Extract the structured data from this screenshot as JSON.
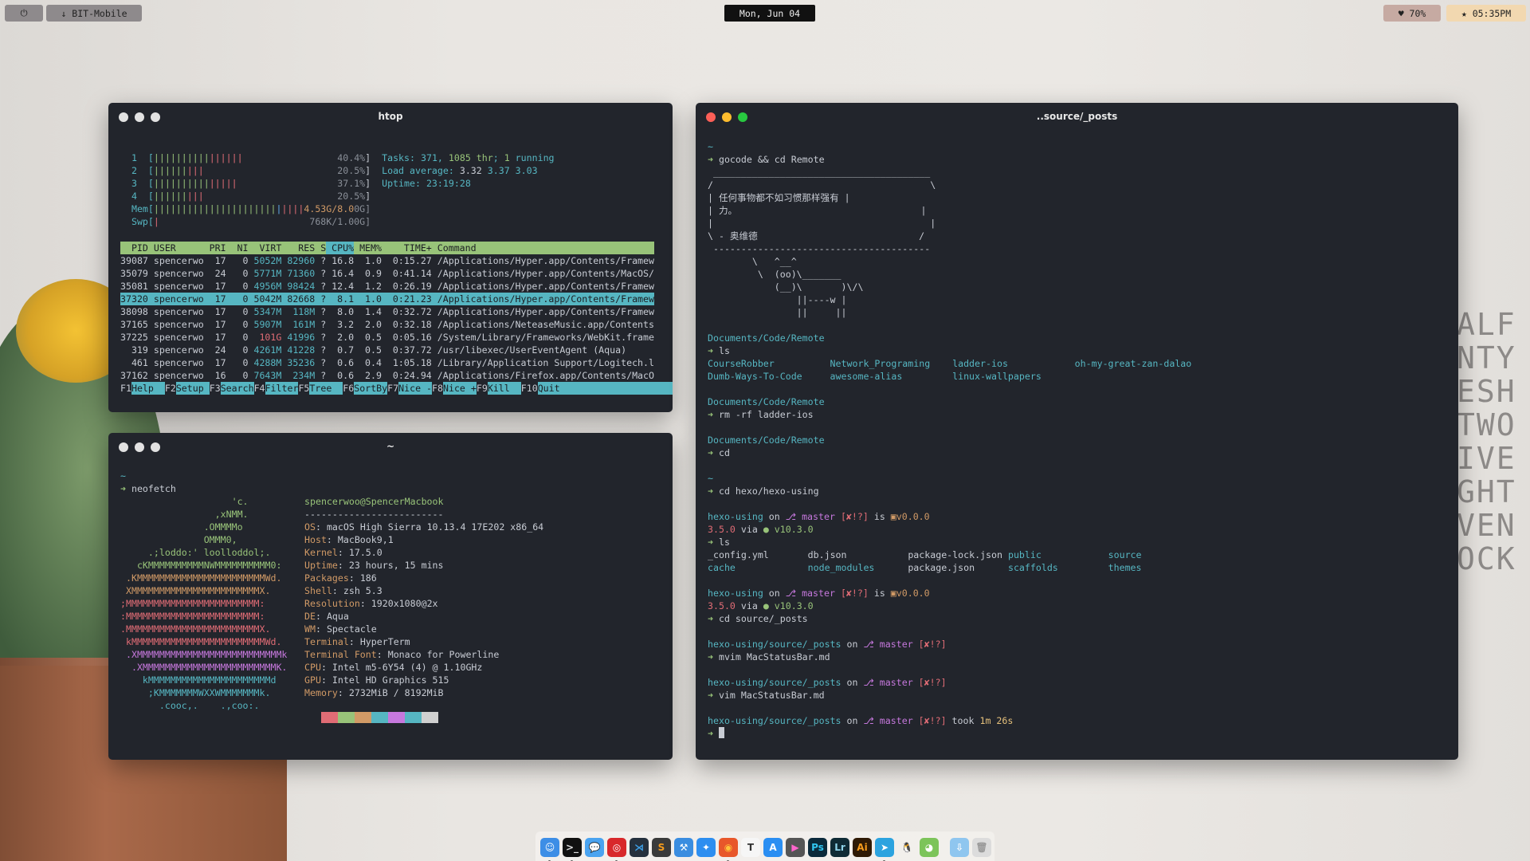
{
  "topbar": {
    "power_icon": "⏻",
    "wifi": "↓ BIT-Mobile",
    "date": "Mon, Jun 04",
    "battery": "♥ 70%",
    "time": "★ 05:35PM"
  },
  "wallpaper": {
    "words": [
      "ALF",
      "NTY",
      "ESH",
      "TWO",
      "IVE",
      "GHT",
      "VEN",
      "OCK"
    ]
  },
  "colors": {
    "terminal_bg": "#22252c",
    "cyan": "#56b6c2",
    "green": "#98c379",
    "red": "#e06c75",
    "magenta": "#c678dd",
    "orange": "#d19a66"
  },
  "htop": {
    "title": "htop",
    "meters": [
      [
        [
          "  1  [",
          "c"
        ],
        [
          "||||||||||",
          "g"
        ],
        [
          "||||||",
          "r"
        ],
        [
          "                 ",
          ""
        ],
        [
          "40.4%",
          "d"
        ],
        [
          "]",
          "w"
        ],
        [
          "  Tasks: ",
          "c"
        ],
        [
          "371, ",
          "c"
        ],
        [
          "1085 thr",
          "g"
        ],
        [
          "; ",
          "c"
        ],
        [
          "1",
          "g"
        ],
        [
          " running",
          "c"
        ]
      ],
      [
        [
          "  2  [",
          "c"
        ],
        [
          "||||||",
          "g"
        ],
        [
          "|||",
          "r"
        ],
        [
          "                        ",
          ""
        ],
        [
          "20.5%",
          "d"
        ],
        [
          "]",
          "w"
        ],
        [
          "  Load average: ",
          "c"
        ],
        [
          "3.32 ",
          "w"
        ],
        [
          "3.37 ",
          "c"
        ],
        [
          "3.03",
          "c"
        ]
      ],
      [
        [
          "  3  [",
          "c"
        ],
        [
          "||||||||||",
          "g"
        ],
        [
          "|||||",
          "r"
        ],
        [
          "                  ",
          ""
        ],
        [
          "37.1%",
          "d"
        ],
        [
          "]",
          "w"
        ],
        [
          "  Uptime: ",
          "c"
        ],
        [
          "23:19:28",
          "c"
        ]
      ],
      [
        [
          "  4  [",
          "c"
        ],
        [
          "||||||",
          "g"
        ],
        [
          "|||",
          "r"
        ],
        [
          "                        ",
          ""
        ],
        [
          "20.5%",
          "d"
        ],
        [
          "]",
          "w"
        ]
      ],
      [
        [
          "  Mem[",
          "c"
        ],
        [
          "||||||||||||||||||||||",
          "g"
        ],
        [
          "|",
          "b"
        ],
        [
          "||||",
          "r"
        ],
        [
          "4.53G/8.0",
          "o"
        ],
        [
          "0G]",
          "d"
        ]
      ],
      [
        [
          "  Swp[",
          "c"
        ],
        [
          "|",
          "r"
        ],
        [
          "                           ",
          ""
        ],
        [
          "768K/1.00G]",
          "d"
        ]
      ]
    ],
    "columns": [
      "PID",
      "USER",
      "PRI",
      "NI",
      "VIRT",
      "RES",
      "S",
      "CPU%",
      "MEM%",
      "TIME+",
      "Command"
    ],
    "sort_column": "CPU%",
    "selected_pid": "37320",
    "processes": [
      {
        "pid": "39087",
        "user": "spencerwo",
        "pri": "17",
        "ni": "0",
        "virt": "5052M",
        "res": "82960",
        "s": "?",
        "cpu": "16.8",
        "mem": "1.0",
        "time": "0:15.27",
        "cmd": "/Applications/Hyper.app/Contents/Framew"
      },
      {
        "pid": "35079",
        "user": "spencerwo",
        "pri": "24",
        "ni": "0",
        "virt": "5771M",
        "res": "71360",
        "s": "?",
        "cpu": "16.4",
        "mem": "0.9",
        "time": "0:41.14",
        "cmd": "/Applications/Hyper.app/Contents/MacOS/"
      },
      {
        "pid": "35081",
        "user": "spencerwo",
        "pri": "17",
        "ni": "0",
        "virt": "4956M",
        "res": "98424",
        "s": "?",
        "cpu": "12.4",
        "mem": "1.2",
        "time": "0:26.19",
        "cmd": "/Applications/Hyper.app/Contents/Framew"
      },
      {
        "pid": "37320",
        "user": "spencerwo",
        "pri": "17",
        "ni": "0",
        "virt": "5042M",
        "res": "82668",
        "s": "?",
        "cpu": "8.1",
        "mem": "1.0",
        "time": "0:21.23",
        "cmd": "/Applications/Hyper.app/Contents/Framew"
      },
      {
        "pid": "38098",
        "user": "spencerwo",
        "pri": "17",
        "ni": "0",
        "virt": "5347M",
        "res": "118M",
        "s": "?",
        "cpu": "8.0",
        "mem": "1.4",
        "time": "0:32.72",
        "cmd": "/Applications/Hyper.app/Contents/Framew"
      },
      {
        "pid": "37165",
        "user": "spencerwo",
        "pri": "17",
        "ni": "0",
        "virt": "5907M",
        "res": "161M",
        "s": "?",
        "cpu": "3.2",
        "mem": "2.0",
        "time": "0:32.18",
        "cmd": "/Applications/NeteaseMusic.app/Contents"
      },
      {
        "pid": "37225",
        "user": "spencerwo",
        "pri": "17",
        "ni": "0",
        "virt": "101G",
        "res": "41996",
        "s": "?",
        "cpu": "2.0",
        "mem": "0.5",
        "time": "0:05.16",
        "cmd": "/System/Library/Frameworks/WebKit.frame",
        "virt_high": true
      },
      {
        "pid": "319",
        "user": "spencerwo",
        "pri": "24",
        "ni": "0",
        "virt": "4261M",
        "res": "41228",
        "s": "?",
        "cpu": "0.7",
        "mem": "0.5",
        "time": "0:37.72",
        "cmd": "/usr/libexec/UserEventAgent (Aqua)"
      },
      {
        "pid": "461",
        "user": "spencerwo",
        "pri": "17",
        "ni": "0",
        "virt": "4288M",
        "res": "35236",
        "s": "?",
        "cpu": "0.6",
        "mem": "0.4",
        "time": "1:05.18",
        "cmd": "/Library/Application Support/Logitech.l"
      },
      {
        "pid": "37162",
        "user": "spencerwo",
        "pri": "16",
        "ni": "0",
        "virt": "7643M",
        "res": "234M",
        "s": "?",
        "cpu": "0.6",
        "mem": "2.9",
        "time": "0:24.94",
        "cmd": "/Applications/Firefox.app/Contents/MacO"
      }
    ],
    "fkeys": [
      [
        "F1",
        "Help  "
      ],
      [
        "F2",
        "Setup "
      ],
      [
        "F3",
        "Search"
      ],
      [
        "F4",
        "Filter"
      ],
      [
        "F5",
        "Tree  "
      ],
      [
        "F6",
        "SortBy"
      ],
      [
        "F7",
        "Nice -"
      ],
      [
        "F8",
        "Nice +"
      ],
      [
        "F9",
        "Kill  "
      ],
      [
        "F10",
        "Quit     "
      ]
    ]
  },
  "neofetch": {
    "title": "~",
    "prompt": [
      [
        [
          "~",
          "c"
        ]
      ],
      [
        [
          "➜ ",
          "g"
        ],
        [
          "neofetch",
          "w"
        ]
      ]
    ],
    "ascii": [
      [
        "                    'c.",
        "g"
      ],
      [
        "                 ,xNMM.",
        "g"
      ],
      [
        "               .OMMMMo",
        "g"
      ],
      [
        "               OMMM0,",
        "g"
      ],
      [
        "     .;loddo:' loolloddol;.",
        "g"
      ],
      [
        "   cKMMMMMMMMMMNWMMMMMMMMMM0:",
        "g"
      ],
      [
        " .KMMMMMMMMMMMMMMMMMMMMMMMWd.",
        "o"
      ],
      [
        " XMMMMMMMMMMMMMMMMMMMMMMMX.",
        "o"
      ],
      [
        ";MMMMMMMMMMMMMMMMMMMMMMMM:",
        "r"
      ],
      [
        ":MMMMMMMMMMMMMMMMMMMMMMMM:",
        "r"
      ],
      [
        ".MMMMMMMMMMMMMMMMMMMMMMMMX.",
        "r"
      ],
      [
        " kMMMMMMMMMMMMMMMMMMMMMMMMWd.",
        "r"
      ],
      [
        " .XMMMMMMMMMMMMMMMMMMMMMMMMMMk",
        "m"
      ],
      [
        "  .XMMMMMMMMMMMMMMMMMMMMMMMMK.",
        "m"
      ],
      [
        "    kMMMMMMMMMMMMMMMMMMMMMMd",
        "c"
      ],
      [
        "     ;KMMMMMMMWXXWMMMMMMMk.",
        "c"
      ],
      [
        "       .cooc,.    .,coo:.",
        "c"
      ]
    ],
    "user_host": "spencerwoo@SpencerMacbook",
    "separator": "-------------------------",
    "info": [
      [
        "OS",
        "macOS High Sierra 10.13.4 17E202 x86_64"
      ],
      [
        "Host",
        "MacBook9,1"
      ],
      [
        "Kernel",
        "17.5.0"
      ],
      [
        "Uptime",
        "23 hours, 15 mins"
      ],
      [
        "Packages",
        "186"
      ],
      [
        "Shell",
        "zsh 5.3"
      ],
      [
        "Resolution",
        "1920x1080@2x"
      ],
      [
        "DE",
        "Aqua"
      ],
      [
        "WM",
        "Spectacle"
      ],
      [
        "Terminal",
        "HyperTerm"
      ],
      [
        "Terminal Font",
        "Monaco for Powerline"
      ],
      [
        "CPU",
        "Intel m5-6Y54 (4) @ 1.10GHz"
      ],
      [
        "GPU",
        "Intel HD Graphics 515"
      ],
      [
        "Memory",
        "2732MiB / 8192MiB"
      ]
    ],
    "color_blocks": [
      "#e06c75",
      "#98c379",
      "#d19a66",
      "#56b6c2",
      "#c678dd",
      "#56b6c2",
      "#d0d0d0"
    ]
  },
  "terminal": {
    "title": "..source/_posts",
    "lines": [
      [
        [
          "~",
          "c"
        ]
      ],
      [
        [
          "➜ ",
          "g"
        ],
        [
          "gocode && cd Remote",
          "w"
        ]
      ],
      [
        [
          " _______________________________________",
          "w"
        ]
      ],
      [
        [
          "/                                       \\",
          "w"
        ]
      ],
      [
        [
          "| 任何事物都不如习惯那样强有 |",
          "w"
        ]
      ],
      [
        [
          "| 力。                                 |",
          "w"
        ]
      ],
      [
        [
          "|                                       |",
          "w"
        ]
      ],
      [
        [
          "\\ - 奥维德                             /",
          "w"
        ]
      ],
      [
        [
          " ---------------------------------------",
          "w"
        ]
      ],
      [
        [
          "        \\   ^__^",
          "w"
        ]
      ],
      [
        [
          "         \\  (oo)\\_______",
          "w"
        ]
      ],
      [
        [
          "            (__)\\       )\\/\\",
          "w"
        ]
      ],
      [
        [
          "                ||----w |",
          "w"
        ]
      ],
      [
        [
          "                ||     ||",
          "w"
        ]
      ],
      [],
      [
        [
          "Documents/Code/Remote",
          "c"
        ]
      ],
      [
        [
          "➜ ",
          "g"
        ],
        [
          "ls",
          "w"
        ]
      ],
      [
        [
          "CourseRobber          Network_Programing    ladder-ios            oh-my-great-zan-dalao",
          "c"
        ]
      ],
      [
        [
          "Dumb-Ways-To-Code     awesome-alias         linux-wallpapers",
          "c"
        ]
      ],
      [],
      [
        [
          "Documents/Code/Remote",
          "c"
        ]
      ],
      [
        [
          "➜ ",
          "g"
        ],
        [
          "rm -rf ladder-ios",
          "w"
        ]
      ],
      [],
      [
        [
          "Documents/Code/Remote",
          "c"
        ]
      ],
      [
        [
          "➜ ",
          "g"
        ],
        [
          "cd",
          "w"
        ]
      ],
      [],
      [
        [
          "~",
          "c"
        ]
      ],
      [
        [
          "➜ ",
          "g"
        ],
        [
          "cd hexo/hexo-using",
          "w"
        ]
      ],
      [],
      [
        [
          "hexo-using",
          "c"
        ],
        [
          " on ",
          "w"
        ],
        [
          "⎇ master",
          "m"
        ],
        [
          " [✘!?]",
          "r"
        ],
        [
          " is ",
          "w"
        ],
        [
          "▣",
          "o"
        ],
        [
          "v0.0.0",
          "o"
        ]
      ],
      [
        [
          "3.5.0",
          "r"
        ],
        [
          " via ",
          "w"
        ],
        [
          "● v10.3.0",
          "g"
        ]
      ],
      [
        [
          "➜ ",
          "g"
        ],
        [
          "ls",
          "w"
        ]
      ],
      [
        [
          "_config.yml",
          "w"
        ],
        [
          "       ",
          ""
        ],
        [
          "db.json",
          "w"
        ],
        [
          "           ",
          ""
        ],
        [
          "package-lock.json",
          "w"
        ],
        [
          " ",
          ""
        ],
        [
          "public",
          "c"
        ],
        [
          "            ",
          ""
        ],
        [
          "source",
          "c"
        ]
      ],
      [
        [
          "cache",
          "c"
        ],
        [
          "             ",
          ""
        ],
        [
          "node_modules",
          "c"
        ],
        [
          "      ",
          ""
        ],
        [
          "package.json",
          "w"
        ],
        [
          "      ",
          ""
        ],
        [
          "scaffolds",
          "c"
        ],
        [
          "         ",
          ""
        ],
        [
          "themes",
          "c"
        ]
      ],
      [],
      [
        [
          "hexo-using",
          "c"
        ],
        [
          " on ",
          "w"
        ],
        [
          "⎇ master",
          "m"
        ],
        [
          " [✘!?]",
          "r"
        ],
        [
          " is ",
          "w"
        ],
        [
          "▣",
          "o"
        ],
        [
          "v0.0.0",
          "o"
        ]
      ],
      [
        [
          "3.5.0",
          "r"
        ],
        [
          " via ",
          "w"
        ],
        [
          "● v10.3.0",
          "g"
        ]
      ],
      [
        [
          "➜ ",
          "g"
        ],
        [
          "cd source/_posts",
          "w"
        ]
      ],
      [],
      [
        [
          "hexo-using/source/_posts",
          "c"
        ],
        [
          " on ",
          "w"
        ],
        [
          "⎇ master",
          "m"
        ],
        [
          " [✘!?]",
          "r"
        ]
      ],
      [
        [
          "➜ ",
          "g"
        ],
        [
          "mvim MacStatusBar.md",
          "w"
        ]
      ],
      [],
      [
        [
          "hexo-using/source/_posts",
          "c"
        ],
        [
          " on ",
          "w"
        ],
        [
          "⎇ master",
          "m"
        ],
        [
          " [✘!?]",
          "r"
        ]
      ],
      [
        [
          "➜ ",
          "g"
        ],
        [
          "vim MacStatusBar.md",
          "w"
        ]
      ],
      [],
      [
        [
          "hexo-using/source/_posts",
          "c"
        ],
        [
          " on ",
          "w"
        ],
        [
          "⎇ master",
          "m"
        ],
        [
          " [✘!?]",
          "r"
        ],
        [
          " took ",
          "w"
        ],
        [
          "1m 26s",
          "y"
        ]
      ],
      [
        [
          "➜ ",
          "g"
        ]
      ]
    ]
  },
  "dock": {
    "items": [
      {
        "name": "finder",
        "glyph": "☺",
        "bg": "#3d8ee6",
        "fg": "#fff",
        "running": true
      },
      {
        "name": "terminal",
        "glyph": ">_",
        "bg": "#111",
        "fg": "#ddd",
        "running": true
      },
      {
        "name": "messages",
        "glyph": "💬",
        "bg": "#4aa3f0",
        "fg": "#fff",
        "running": false
      },
      {
        "name": "netease-music",
        "glyph": "◎",
        "bg": "#d8282b",
        "fg": "#fff",
        "running": true
      },
      {
        "name": "vscode",
        "glyph": "⋊",
        "bg": "#25303d",
        "fg": "#3da0e8",
        "running": false
      },
      {
        "name": "sublime-text",
        "glyph": "S",
        "bg": "#3a3a3a",
        "fg": "#f59b1c",
        "running": false
      },
      {
        "name": "xcode",
        "glyph": "⚒",
        "bg": "#3a8de0",
        "fg": "#fff",
        "running": false
      },
      {
        "name": "safari",
        "glyph": "✦",
        "bg": "#2d8ef0",
        "fg": "#fff",
        "running": false
      },
      {
        "name": "firefox",
        "glyph": "◉",
        "bg": "#e8572a",
        "fg": "#ffc33a",
        "running": true
      },
      {
        "name": "typora",
        "glyph": "T",
        "bg": "#f6f6f6",
        "fg": "#333",
        "running": false
      },
      {
        "name": "app-store",
        "glyph": "A",
        "bg": "#2a8ef2",
        "fg": "#fff",
        "running": false
      },
      {
        "name": "final-cut-pro",
        "glyph": "▶",
        "bg": "#555",
        "fg": "#f6c",
        "running": false
      },
      {
        "name": "photoshop",
        "glyph": "Ps",
        "bg": "#0b2a3b",
        "fg": "#31c5f0",
        "running": false
      },
      {
        "name": "lightroom",
        "glyph": "Lr",
        "bg": "#0f2b35",
        "fg": "#8fd4ea",
        "running": false
      },
      {
        "name": "illustrator",
        "glyph": "Ai",
        "bg": "#2f1a05",
        "fg": "#f59b1c",
        "running": false
      },
      {
        "name": "telegram",
        "glyph": "➤",
        "bg": "#2ca3df",
        "fg": "#fff",
        "running": true
      },
      {
        "name": "qq",
        "glyph": "🐧",
        "bg": "transparent",
        "fg": "#111",
        "running": false
      },
      {
        "name": "wechat",
        "glyph": "◕",
        "bg": "#7cc45a",
        "fg": "#fff",
        "running": false
      }
    ],
    "stack_items": [
      {
        "name": "downloads",
        "glyph": "⇩",
        "bg": "#8fc6ef",
        "fg": "#fff"
      },
      {
        "name": "trash",
        "glyph": "🗑",
        "bg": "#dcdcdc",
        "fg": "#999"
      }
    ]
  }
}
